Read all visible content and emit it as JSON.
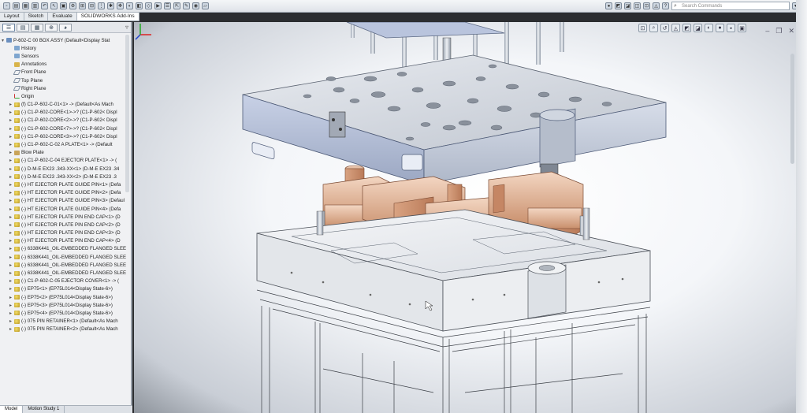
{
  "toolbar": {
    "search_placeholder": "Search Commands"
  },
  "command_tabs": [
    "Layout",
    "Sketch",
    "Evaluate",
    "SOLIDWORKS Add-Ins"
  ],
  "feature_manager": {
    "root": "P-602-C 00 BOX ASSY  (Default<Display Stat",
    "items": [
      {
        "label": "History",
        "icon": "history"
      },
      {
        "label": "Sensors",
        "icon": "sensor"
      },
      {
        "label": "Annotations",
        "icon": "annotation"
      },
      {
        "label": "Front Plane",
        "icon": "plane"
      },
      {
        "label": "Top Plane",
        "icon": "plane"
      },
      {
        "label": "Right Plane",
        "icon": "plane"
      },
      {
        "label": "Origin",
        "icon": "origin"
      },
      {
        "label": "(f) C1-P-602-C-01<1> -> (Default<As Mach",
        "icon": "part"
      },
      {
        "label": "(-) C1-P-602-CORE<1>->? (C1-P-602< Displ",
        "icon": "part"
      },
      {
        "label": "(-) C1-P-602-CORE<2>->? (C1-P-602< Displ",
        "icon": "part"
      },
      {
        "label": "(-) C1-P-602-CORE<7>->? (C1-P-602< Displ",
        "icon": "part"
      },
      {
        "label": "(-) C1-P-602-CORE<3>->? (C1-P-602< Displ",
        "icon": "part"
      },
      {
        "label": "(-) C1-P-602-C-02 A PLATE<1> -> (Default",
        "icon": "part"
      },
      {
        "label": "Blow Plate",
        "icon": "folder"
      },
      {
        "label": "(-) C1-P-602-C-04 EJECTOR PLATE<1> -> (",
        "icon": "part"
      },
      {
        "label": "(-) D-M-E EX23 .343-XX<1> (D-M-E EX23 .34",
        "icon": "part"
      },
      {
        "label": "(-) D-M-E EX23 .343-XX<2> (D-M-E EX23 .3",
        "icon": "part"
      },
      {
        "label": "(-) HT EJECTOR PLATE GUIDE PIN<1> (Defa",
        "icon": "part"
      },
      {
        "label": "(-) HT EJECTOR PLATE GUIDE PIN<2> (Defa",
        "icon": "part"
      },
      {
        "label": "(-) HT EJECTOR PLATE GUIDE PIN<3> (Defaul",
        "icon": "part"
      },
      {
        "label": "(-) HT EJECTOR PLATE GUIDE PIN<4> (Defa",
        "icon": "part"
      },
      {
        "label": "(-) HT EJECTOR PLATE PIN END CAP<1> (D",
        "icon": "part"
      },
      {
        "label": "(-) HT EJECTOR PLATE PIN END CAP<2> (D",
        "icon": "part"
      },
      {
        "label": "(-) HT EJECTOR PLATE PIN END CAP<3> (D",
        "icon": "part"
      },
      {
        "label": "(-) HT EJECTOR PLATE PIN END CAP<4> (D",
        "icon": "part"
      },
      {
        "label": "(-) 6338K441_OIL-EMBEDDED FLANGED SLEE",
        "icon": "part"
      },
      {
        "label": "(-) 6338K441_OIL-EMBEDDED FLANGED SLEE",
        "icon": "part"
      },
      {
        "label": "(-) 6338K441_OIL-EMBEDDED FLANGED SLEE",
        "icon": "part"
      },
      {
        "label": "(-) 6338K441_OIL-EMBEDDED FLANGED SLEE",
        "icon": "part"
      },
      {
        "label": "(-) C1-P-602-C-05 EJECTOR COVER<1> -> (",
        "icon": "part"
      },
      {
        "label": "(-) EP75<1> (EP75L014<Display State-6>)",
        "icon": "part"
      },
      {
        "label": "(-) EP75<2> (EP75L014<Display State-6>)",
        "icon": "part"
      },
      {
        "label": "(-) EP75<3> (EP75L014<Display State-6>)",
        "icon": "part"
      },
      {
        "label": "(-) EP75<4> (EP75L014<Display State-6>)",
        "icon": "part"
      },
      {
        "label": "(-) 075 PIN RETAINER<1> (Default<As Mach",
        "icon": "part"
      },
      {
        "label": "(-) 075 PIN RETAINER<2> (Default<As Mach",
        "icon": "part"
      }
    ],
    "bottom_tabs": [
      "Model",
      "Motion Study 1"
    ]
  }
}
